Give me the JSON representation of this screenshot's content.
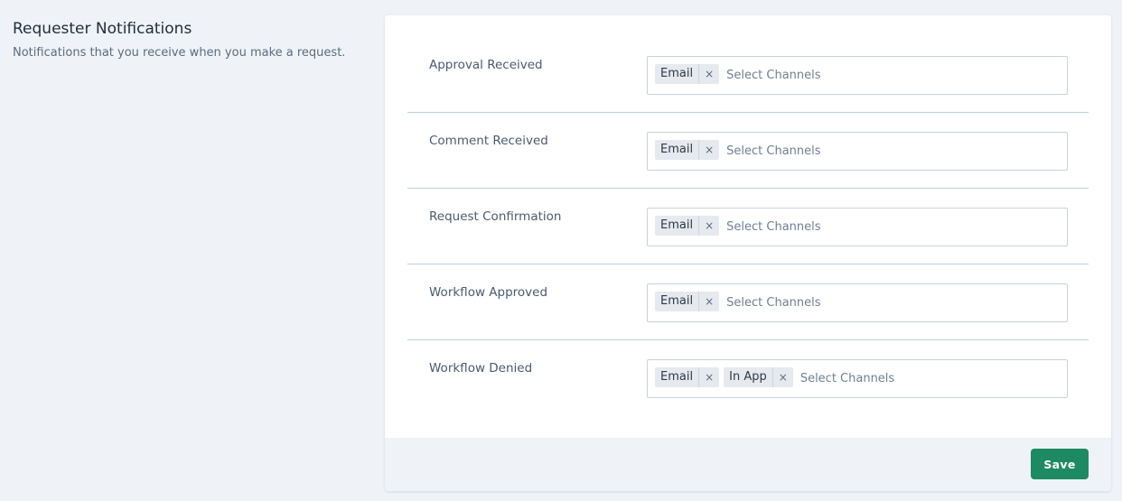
{
  "section": {
    "title": "Requester Notifications",
    "description": "Notifications that you receive when you make a request."
  },
  "rows": [
    {
      "label": "Approval Received",
      "chips": [
        "Email"
      ],
      "placeholder": "Select Channels"
    },
    {
      "label": "Comment Received",
      "chips": [
        "Email"
      ],
      "placeholder": "Select Channels"
    },
    {
      "label": "Request Confirmation",
      "chips": [
        "Email"
      ],
      "placeholder": "Select Channels"
    },
    {
      "label": "Workflow Approved",
      "chips": [
        "Email"
      ],
      "placeholder": "Select Channels"
    },
    {
      "label": "Workflow Denied",
      "chips": [
        "Email",
        "In App"
      ],
      "placeholder": "Select Channels"
    }
  ],
  "chip_remove_glyph": "×",
  "footer": {
    "save_label": "Save"
  },
  "colors": {
    "page_background": "#eff3f8",
    "card_background": "#ffffff",
    "primary_button": "#1e8a63",
    "row_divider": "#bcd0d6",
    "chip_background": "#e6e9ee"
  }
}
